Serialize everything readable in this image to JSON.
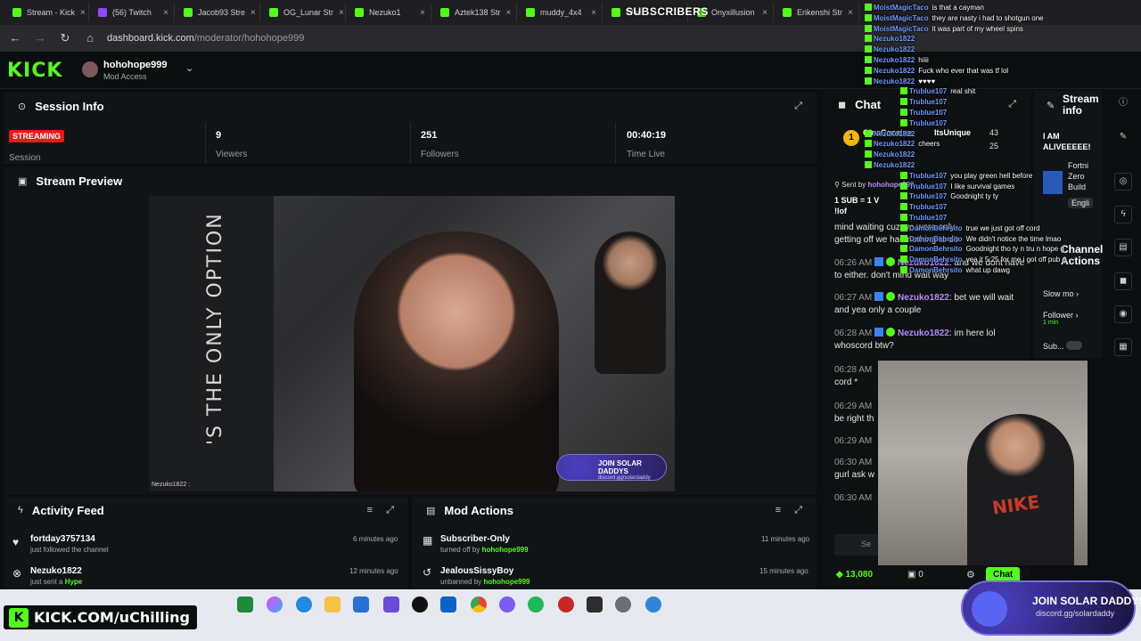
{
  "browser": {
    "tabs": [
      {
        "label": "Stream - Kick"
      },
      {
        "label": "(56) Twitch"
      },
      {
        "label": "Jacob93 Stre"
      },
      {
        "label": "OG_Lunar Str"
      },
      {
        "label": "Nezuko1"
      },
      {
        "label": "Aztek138 Str"
      },
      {
        "label": "muddy_4x4"
      },
      {
        "label": "Wes"
      },
      {
        "label": "Onyxillusion"
      },
      {
        "label": "Erikenshi Str"
      }
    ],
    "url_host": "dashboard.kick.com",
    "url_path": "/moderator/hohohope999"
  },
  "header": {
    "logo": "KICK",
    "channel": "hohohope999",
    "role": "Mod Access"
  },
  "session": {
    "title": "Session Info",
    "status": "STREAMING",
    "session_label": "Session",
    "stats": [
      {
        "value": "9",
        "label": "Viewers"
      },
      {
        "value": "251",
        "label": "Followers"
      },
      {
        "value": "00:40:19",
        "label": "Time Live"
      }
    ]
  },
  "preview": {
    "title": "Stream Preview",
    "wall_text": "'S THE ONLY OPTION",
    "overlay_title": "JOIN SOLAR DADDYS",
    "overlay_sub": "discord.gg/solardaddy",
    "name_tag": "Nezuko1822 :"
  },
  "activity": {
    "title": "Activity Feed",
    "items": [
      {
        "who": "fortday3757134",
        "what": "just followed the channel",
        "time": "6 minutes ago"
      },
      {
        "who": "Nezuko1822",
        "what_prefix": "just sent a ",
        "what_highlight": "Hype",
        "time": "12 minutes ago"
      }
    ]
  },
  "mod_actions": {
    "title": "Mod Actions",
    "items": [
      {
        "who": "Subscriber-Only",
        "what_prefix": "turned off by ",
        "what_highlight": "hohohope999",
        "time": "11 minutes ago"
      },
      {
        "who": "JealousSissyBoy",
        "what_prefix": "unbanned by ",
        "what_highlight": "hohohope999",
        "time": "15 minutes ago"
      }
    ]
  },
  "chat": {
    "title": "Chat",
    "pinned_user": "GinaCocaine",
    "pinned_user2": "ItsUnique",
    "pinned_count1": "43",
    "pinned_count2": "25",
    "sent_by": "Sent by",
    "sent_by_user": "hohohope999",
    "sub_line": "1 SUB = 1 V",
    "lof": "!lof",
    "messages": [
      {
        "ts": "",
        "name": "",
        "text": "mind waiting cuz we were only getting off we had nothing to do"
      },
      {
        "ts": "06:26 AM",
        "name": "Nezuko1822",
        "text": ": and we dont have to either. don't mind wait way"
      },
      {
        "ts": "06:27 AM",
        "name": "Nezuko1822",
        "text": ": bet we will wait and yea only a couple"
      },
      {
        "ts": "06:28 AM",
        "name": "Nezuko1822",
        "text": ": im here lol whoscord btw?"
      },
      {
        "ts": "06:28 AM",
        "name": "",
        "text": "cord *"
      },
      {
        "ts": "06:29 AM",
        "name": "",
        "text": "be right th"
      },
      {
        "ts": "06:29 AM",
        "name": "",
        "text": ""
      },
      {
        "ts": "06:30 AM",
        "name": "",
        "text": "gurl ask w"
      },
      {
        "ts": "06:30 AM",
        "name": "",
        "text": ""
      }
    ],
    "send_placeholder": "Se",
    "kicks": "13,080",
    "zero": "0",
    "chat_button": "Chat"
  },
  "stream_info": {
    "title": "Stream info",
    "status_text": "I AM ALIVEEEEE!",
    "game_lines": [
      "Fortni",
      "Zero",
      "Build"
    ],
    "lang": "Engli",
    "actions_title": "Channel Actions",
    "slow_mode": "Slow mo",
    "follower": "Follower",
    "follower_sub": "1 min",
    "sub": "Sub..."
  },
  "overlay_chat": [
    {
      "user": "MoistMagicTaco",
      "text": "is that a cayman"
    },
    {
      "user": "MoistMagicTaco",
      "text": "they are nasty i had to shotgun one"
    },
    {
      "user": "MoistMagicTaco",
      "text": "it was part of my wheel spins"
    },
    {
      "user": "Nezuko1822",
      "text": ""
    },
    {
      "user": "Nezuko1822",
      "text": ""
    },
    {
      "user": "Nezuko1822",
      "text": "hiiii"
    },
    {
      "user": "Nezuko1822",
      "text": "Fuck who ever that was tf lol"
    },
    {
      "user": "Nezuko1822",
      "text": "♥♥♥♥"
    },
    {
      "user": "Trublue107",
      "text": "real shit"
    },
    {
      "user": "Trublue107",
      "text": ""
    },
    {
      "user": "Trublue107",
      "text": ""
    },
    {
      "user": "Trublue107",
      "text": ""
    },
    {
      "user": "Nezuko1822",
      "text": ""
    },
    {
      "user": "Nezuko1822",
      "text": "cheers"
    },
    {
      "user": "Nezuko1822",
      "text": ""
    },
    {
      "user": "Nezuko1822",
      "text": ""
    },
    {
      "user": "Trublue107",
      "text": "you play green hell before"
    },
    {
      "user": "Trublue107",
      "text": "I like survival games"
    },
    {
      "user": "Trublue107",
      "text": "Goodnight ty ty"
    },
    {
      "user": "Trublue107",
      "text": ""
    },
    {
      "user": "Trublue107",
      "text": ""
    },
    {
      "user": "DamonBehrsito",
      "text": "true we just got off cord"
    },
    {
      "user": "DamonBehrsito",
      "text": "We didn't notice the time lmao"
    },
    {
      "user": "DamonBehrsito",
      "text": "Goodnight tho ty n tru n hope g"
    },
    {
      "user": "DamonBehrsito",
      "text": "yea it 5:25 for me i got off pub g"
    },
    {
      "user": "DamonBehrsito",
      "text": "what up dawg"
    }
  ],
  "subscribers_label": "SUBSCRIBERS",
  "cam": {
    "shirt": "NIKE"
  },
  "taskbar": {
    "ad_text": "KICK.COM/uChilling",
    "join_title": "JOIN SOLAR DADDYS",
    "join_sub": "discord.gg/solardaddy"
  }
}
